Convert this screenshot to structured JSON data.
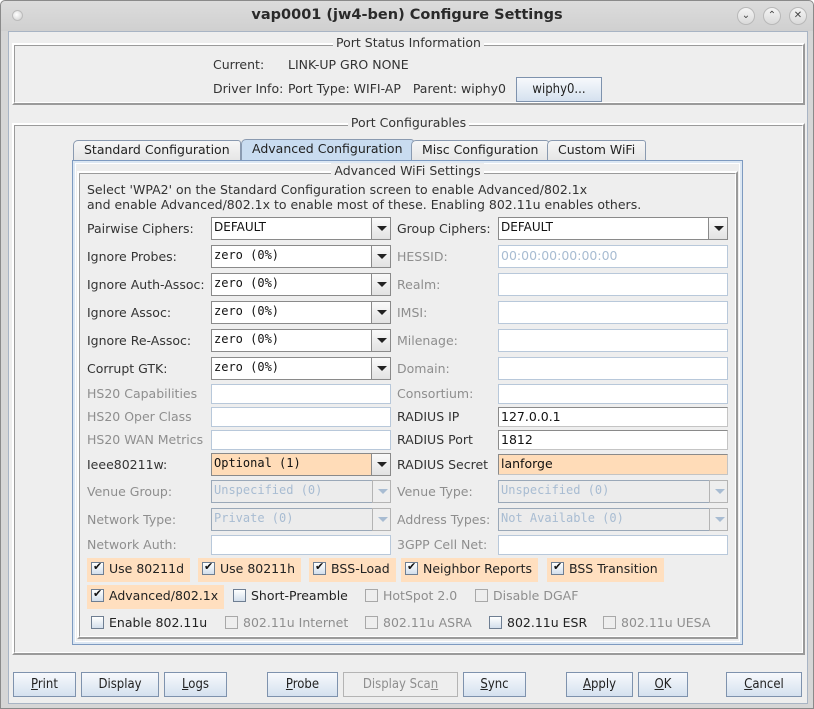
{
  "window": {
    "title": "vap0001  (jw4-ben) Configure Settings",
    "controls": {
      "minimize": "⌄",
      "maximize": "⌃",
      "close": "✕"
    }
  },
  "port_status": {
    "title": "Port Status Information",
    "current_label": "Current:",
    "current_value": "LINK-UP GRO  NONE",
    "driver_label": "Driver Info:",
    "driver_value": "Port Type: WIFI-AP   Parent: wiphy0",
    "wiphy_button": "wiphy0..."
  },
  "port_configurables": {
    "title": "Port Configurables",
    "tabs": [
      {
        "label": "Standard Configuration",
        "active": false
      },
      {
        "label": "Advanced Configuration",
        "active": true
      },
      {
        "label": "Misc Configuration",
        "active": false
      },
      {
        "label": "Custom WiFi",
        "active": false
      }
    ]
  },
  "advanced": {
    "title": "Advanced WiFi Settings",
    "info_line1": "Select 'WPA2' on the Standard Configuration screen to enable Advanced/802.1x",
    "info_line2": "and enable Advanced/802.1x to enable most of these. Enabling 802.11u enables others.",
    "left": {
      "pairwise_ciphers": {
        "label": "Pairwise Ciphers:",
        "value": "DEFAULT"
      },
      "ignore_probes": {
        "label": "Ignore Probes:",
        "value": "zero (0%)"
      },
      "ignore_auth_assoc": {
        "label": "Ignore Auth-Assoc:",
        "value": "zero (0%)"
      },
      "ignore_assoc": {
        "label": "Ignore Assoc:",
        "value": "zero (0%)"
      },
      "ignore_reassoc": {
        "label": "Ignore Re-Assoc:",
        "value": "zero (0%)"
      },
      "corrupt_gtk": {
        "label": "Corrupt GTK:",
        "value": "zero (0%)"
      },
      "hs20_capabilities": {
        "label": "HS20 Capabilities",
        "value": ""
      },
      "hs20_oper_class": {
        "label": "HS20 Oper Class",
        "value": ""
      },
      "hs20_wan_metrics": {
        "label": "HS20 WAN Metrics",
        "value": ""
      },
      "ieee80211w": {
        "label": "Ieee80211w:",
        "value": "Optional (1)"
      },
      "venue_group": {
        "label": "Venue Group:",
        "value": "Unspecified (0)"
      },
      "network_type": {
        "label": "Network Type:",
        "value": "Private (0)"
      },
      "network_auth": {
        "label": "Network Auth:",
        "value": ""
      }
    },
    "right": {
      "group_ciphers": {
        "label": "Group Ciphers:",
        "value": "DEFAULT"
      },
      "hessid": {
        "label": "HESSID:",
        "value": "00:00:00:00:00:00"
      },
      "realm": {
        "label": "Realm:",
        "value": ""
      },
      "imsi": {
        "label": "IMSI:",
        "value": ""
      },
      "milenage": {
        "label": "Milenage:",
        "value": ""
      },
      "domain": {
        "label": "Domain:",
        "value": ""
      },
      "consortium": {
        "label": "Consortium:",
        "value": ""
      },
      "radius_ip": {
        "label": "RADIUS IP",
        "value": "127.0.0.1"
      },
      "radius_port": {
        "label": "RADIUS Port",
        "value": "1812"
      },
      "radius_secret": {
        "label": "RADIUS Secret",
        "value": "lanforge"
      },
      "venue_type": {
        "label": "Venue Type:",
        "value": "Unspecified (0)"
      },
      "address_types": {
        "label": "Address Types:",
        "value": "Not Available (0)"
      },
      "cell_net": {
        "label": "3GPP Cell Net:",
        "value": ""
      }
    },
    "checkboxes": [
      {
        "label": "Use 80211d",
        "checked": true,
        "enabled": true,
        "highlight": true
      },
      {
        "label": "Use 80211h",
        "checked": true,
        "enabled": true,
        "highlight": true
      },
      {
        "label": "BSS-Load",
        "checked": true,
        "enabled": true,
        "highlight": true
      },
      {
        "label": "Neighbor Reports",
        "checked": true,
        "enabled": true,
        "highlight": true
      },
      {
        "label": "BSS Transition",
        "checked": true,
        "enabled": true,
        "highlight": true
      },
      {
        "label": "Advanced/802.1x",
        "checked": true,
        "enabled": true,
        "highlight": true
      },
      {
        "label": "Short-Preamble",
        "checked": false,
        "enabled": true,
        "highlight": false
      },
      {
        "label": "HotSpot 2.0",
        "checked": false,
        "enabled": false,
        "highlight": false
      },
      {
        "label": "Disable DGAF",
        "checked": false,
        "enabled": false,
        "highlight": false
      },
      {
        "label": "Enable 802.11u",
        "checked": false,
        "enabled": true,
        "highlight": false
      },
      {
        "label": "802.11u Internet",
        "checked": false,
        "enabled": false,
        "highlight": false
      },
      {
        "label": "802.11u ASRA",
        "checked": false,
        "enabled": false,
        "highlight": false
      },
      {
        "label": "802.11u ESR",
        "checked": false,
        "enabled": true,
        "highlight": false
      },
      {
        "label": "802.11u UESA",
        "checked": false,
        "enabled": false,
        "highlight": false
      }
    ]
  },
  "buttons": {
    "print": {
      "pre": "",
      "u": "P",
      "post": "rint"
    },
    "display": {
      "pre": "Display",
      "u": "",
      "post": ""
    },
    "logs": {
      "pre": "",
      "u": "L",
      "post": "ogs"
    },
    "probe": {
      "pre": "",
      "u": "P",
      "post": "robe"
    },
    "display_scan": {
      "pre": "Display Sca",
      "u": "n",
      "post": ""
    },
    "sync": {
      "pre": "",
      "u": "S",
      "post": "ync"
    },
    "apply": {
      "pre": "",
      "u": "A",
      "post": "pply"
    },
    "ok": {
      "pre": "",
      "u": "O",
      "post": "K"
    },
    "cancel": {
      "pre": "",
      "u": "C",
      "post": "ancel"
    }
  },
  "colors": {
    "highlight_orange": "#ffdcb8",
    "active_tab": "#c9dcf0",
    "button_border": "#7e92ad"
  }
}
